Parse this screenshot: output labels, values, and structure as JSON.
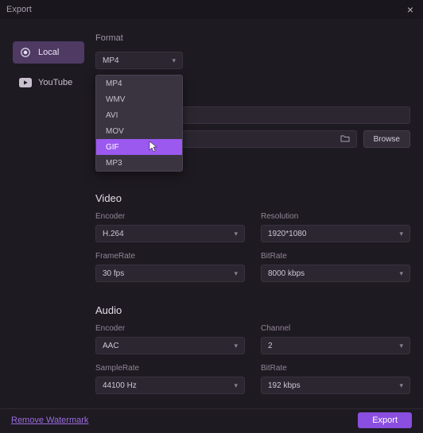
{
  "window": {
    "title": "Export"
  },
  "sidebar": {
    "items": [
      {
        "label": "Local",
        "icon": "disk-icon",
        "active": true
      },
      {
        "label": "YouTube",
        "icon": "youtube-icon",
        "active": false
      }
    ]
  },
  "format": {
    "label": "Format",
    "selected": "MP4",
    "options": [
      "MP4",
      "WMV",
      "AVI",
      "MOV",
      "GIF",
      "MP3"
    ],
    "highlighted": "GIF"
  },
  "saveto": {
    "browse_label": "Browse"
  },
  "video": {
    "heading": "Video",
    "encoder": {
      "label": "Encoder",
      "value": "H.264"
    },
    "resolution": {
      "label": "Resolution",
      "value": "1920*1080"
    },
    "framerate": {
      "label": "FrameRate",
      "value": "30 fps"
    },
    "bitrate": {
      "label": "BitRate",
      "value": "8000 kbps"
    }
  },
  "audio": {
    "heading": "Audio",
    "encoder": {
      "label": "Encoder",
      "value": "AAC"
    },
    "channel": {
      "label": "Channel",
      "value": "2"
    },
    "samplerate": {
      "label": "SampleRate",
      "value": "44100 Hz"
    },
    "bitrate": {
      "label": "BitRate",
      "value": "192 kbps"
    }
  },
  "footer": {
    "watermark_link": "Remove Watermark",
    "export_label": "Export"
  }
}
